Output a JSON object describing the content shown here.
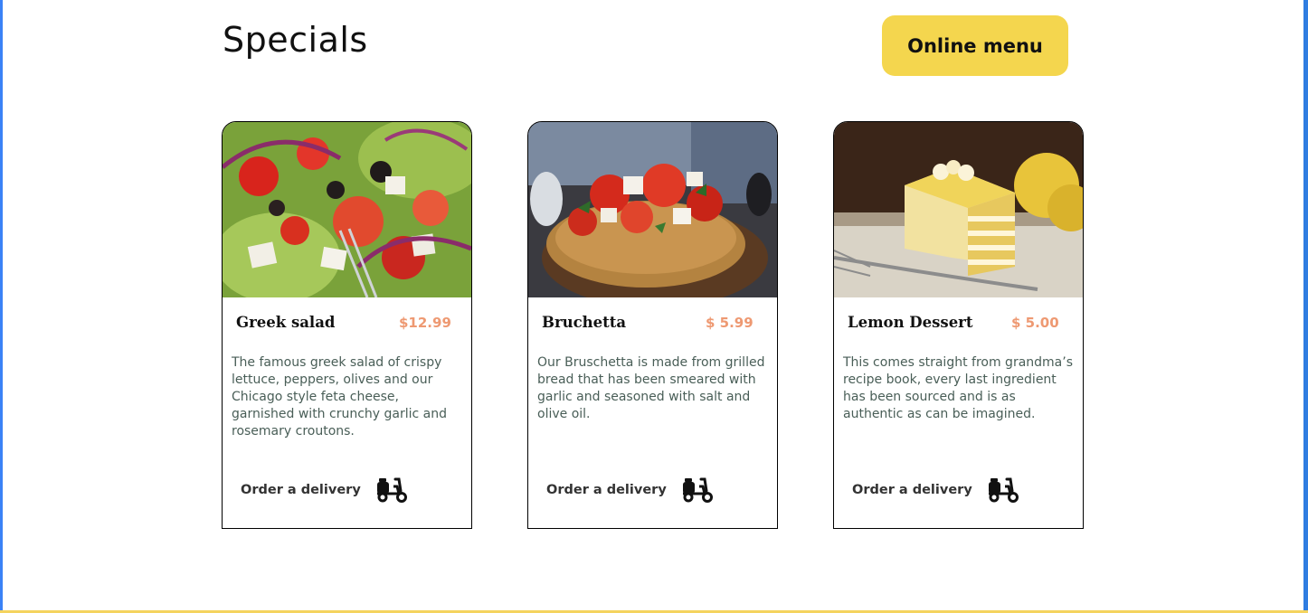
{
  "section": {
    "title": "Specials",
    "menu_button_label": "Online menu"
  },
  "cards": [
    {
      "name": "Greek salad",
      "price": "$12.99",
      "description": "The famous greek salad of crispy lettuce, peppers, olives and our Chicago style feta cheese, garnished with crunchy garlic and rosemary croutons.",
      "order_label": "Order a delivery",
      "image": "greek-salad-photo"
    },
    {
      "name": "Bruchetta",
      "price": "$ 5.99",
      "description": "Our Bruschetta is made from grilled bread that has been smeared with garlic and seasoned with salt and olive oil.",
      "order_label": "Order a delivery",
      "image": "bruschetta-photo"
    },
    {
      "name": "Lemon Dessert",
      "price": "$ 5.00",
      "description": "This comes straight from grandma’s recipe book, every last ingredient has been sourced and is as authentic as can be imagined.",
      "order_label": "Order a delivery",
      "image": "lemon-dessert-photo"
    }
  ],
  "icons": {
    "order": "delivery-scooter-icon"
  },
  "colors": {
    "accent_yellow": "#F4D64E",
    "price": "#EE9972",
    "description_text": "#495E57"
  }
}
